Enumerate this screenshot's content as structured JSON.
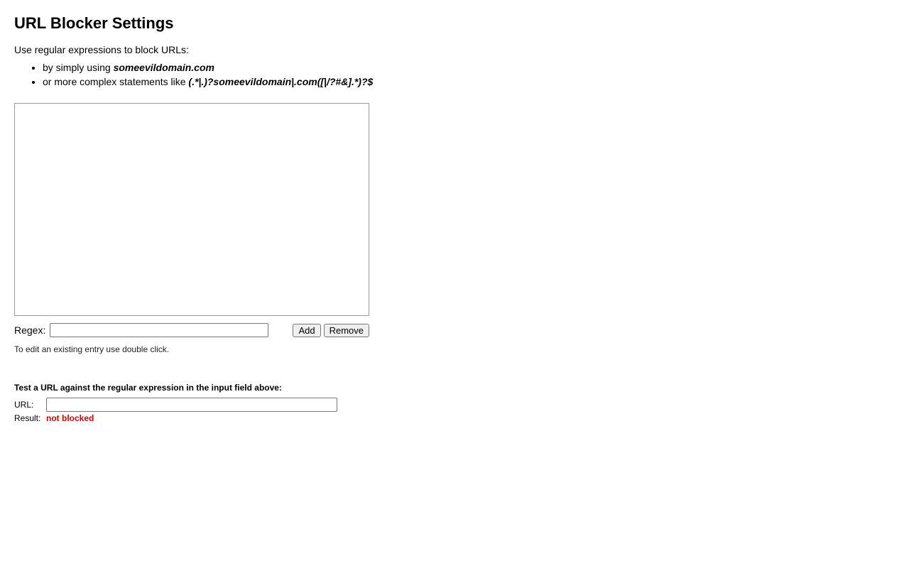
{
  "title": "URL Blocker Settings",
  "intro": "Use regular expressions to block URLs:",
  "examples": {
    "line1_prefix": "by simply using ",
    "line1_em": "someevildomain.com",
    "line2_prefix": "or more complex statements like ",
    "line2_em": "(.*|.)?someevildomain|.com([|/?#&].*)?$"
  },
  "regex": {
    "label": "Regex:",
    "value": "",
    "add_label": "Add",
    "remove_label": "Remove"
  },
  "edit_hint": "To edit an existing entry use double click.",
  "test": {
    "heading": "Test a URL against the regular expression in the input field above:",
    "url_label": "URL:",
    "url_value": "",
    "result_label": "Result:",
    "result_value": "not blocked"
  }
}
